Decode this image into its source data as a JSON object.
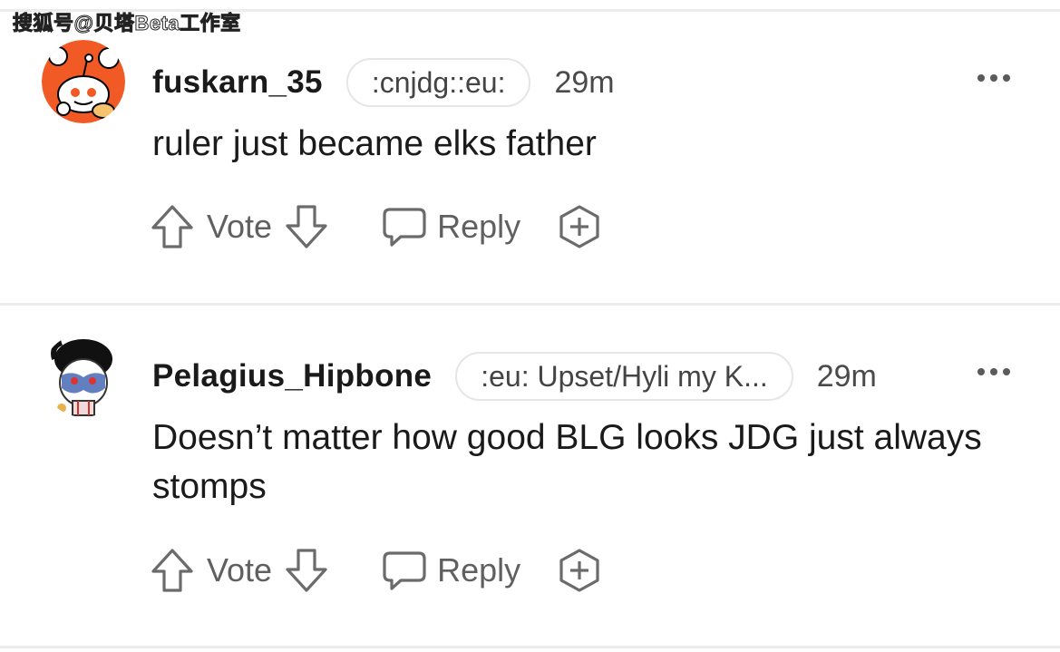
{
  "watermark": "搜狐号@贝塔Beta工作室",
  "comments": [
    {
      "username": "fuskarn_35",
      "flair": ":cnjdg::eu:",
      "time": "29m",
      "text": "ruler just became elks father",
      "actions": {
        "vote_label": "Vote",
        "reply_label": "Reply"
      }
    },
    {
      "username": "Pelagius_Hipbone",
      "flair": ":eu: Upset/Hyli my K...",
      "time": "29m",
      "text": "Doesn’t matter how good BLG looks JDG just always stomps",
      "actions": {
        "vote_label": "Vote",
        "reply_label": "Reply"
      }
    }
  ],
  "icons": {
    "upvote": "upvote-arrow-icon",
    "downvote": "downvote-arrow-icon",
    "reply": "speech-bubble-icon",
    "award": "award-plus-icon",
    "more": "more-options-icon"
  },
  "colors": {
    "avatar1_bg": "#f15a24",
    "icon_gray": "#6b6b6b",
    "separator": "#ececec"
  }
}
